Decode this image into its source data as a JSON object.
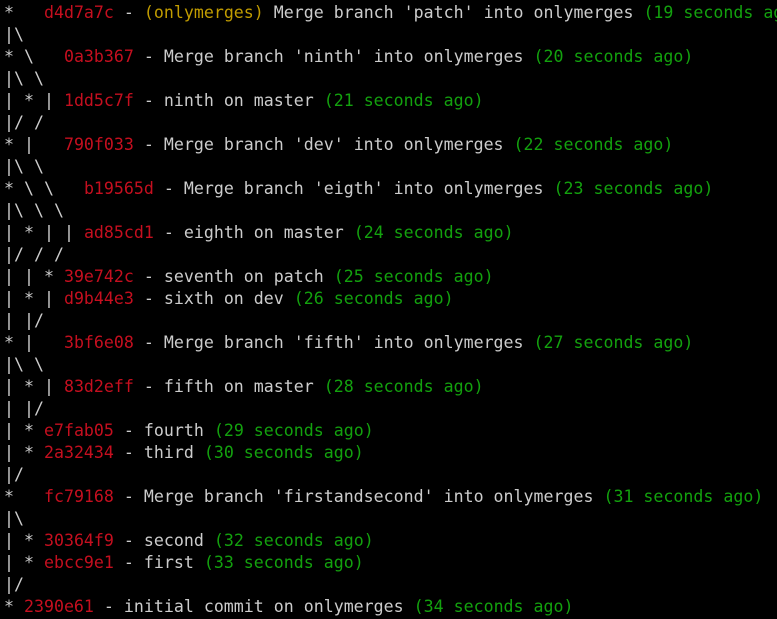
{
  "colors": {
    "background": "#000000",
    "text": "#cccccc",
    "hash": "#c50f1f",
    "refs": "#c19c00",
    "time": "#13a10e"
  },
  "log": [
    {
      "graph": "*   ",
      "hash": "d4d7a7c",
      "refs": "(onlymerges)",
      "message": "Merge branch 'patch' into onlymerges",
      "time": "(19 seconds ago)"
    },
    {
      "graph": "|\\"
    },
    {
      "graph": "* \\   ",
      "hash": "0a3b367",
      "message": "Merge branch 'ninth' into onlymerges",
      "time": "(20 seconds ago)"
    },
    {
      "graph": "|\\ \\"
    },
    {
      "graph": "| * | ",
      "hash": "1dd5c7f",
      "message": "ninth on master",
      "time": "(21 seconds ago)"
    },
    {
      "graph": "|/ /"
    },
    {
      "graph": "* |   ",
      "hash": "790f033",
      "message": "Merge branch 'dev' into onlymerges",
      "time": "(22 seconds ago)"
    },
    {
      "graph": "|\\ \\"
    },
    {
      "graph": "* \\ \\   ",
      "hash": "b19565d",
      "message": "Merge branch 'eigth' into onlymerges",
      "time": "(23 seconds ago)"
    },
    {
      "graph": "|\\ \\ \\"
    },
    {
      "graph": "| * | | ",
      "hash": "ad85cd1",
      "message": "eighth on master",
      "time": "(24 seconds ago)"
    },
    {
      "graph": "|/ / /"
    },
    {
      "graph": "| | * ",
      "hash": "39e742c",
      "message": "seventh on patch",
      "time": "(25 seconds ago)"
    },
    {
      "graph": "| * | ",
      "hash": "d9b44e3",
      "message": "sixth on dev",
      "time": "(26 seconds ago)"
    },
    {
      "graph": "| |/"
    },
    {
      "graph": "* |   ",
      "hash": "3bf6e08",
      "message": "Merge branch 'fifth' into onlymerges",
      "time": "(27 seconds ago)"
    },
    {
      "graph": "|\\ \\"
    },
    {
      "graph": "| * | ",
      "hash": "83d2eff",
      "message": "fifth on master",
      "time": "(28 seconds ago)"
    },
    {
      "graph": "| |/"
    },
    {
      "graph": "| * ",
      "hash": "e7fab05",
      "message": "fourth",
      "time": "(29 seconds ago)"
    },
    {
      "graph": "| * ",
      "hash": "2a32434",
      "message": "third",
      "time": "(30 seconds ago)"
    },
    {
      "graph": "|/"
    },
    {
      "graph": "*   ",
      "hash": "fc79168",
      "message": "Merge branch 'firstandsecond' into onlymerges",
      "time": "(31 seconds ago)"
    },
    {
      "graph": "|\\"
    },
    {
      "graph": "| * ",
      "hash": "30364f9",
      "message": "second",
      "time": "(32 seconds ago)"
    },
    {
      "graph": "| * ",
      "hash": "ebcc9e1",
      "message": "first",
      "time": "(33 seconds ago)"
    },
    {
      "graph": "|/"
    },
    {
      "graph": "* ",
      "hash": "2390e61",
      "message": "initial commit on onlymerges",
      "time": "(34 seconds ago)"
    }
  ]
}
